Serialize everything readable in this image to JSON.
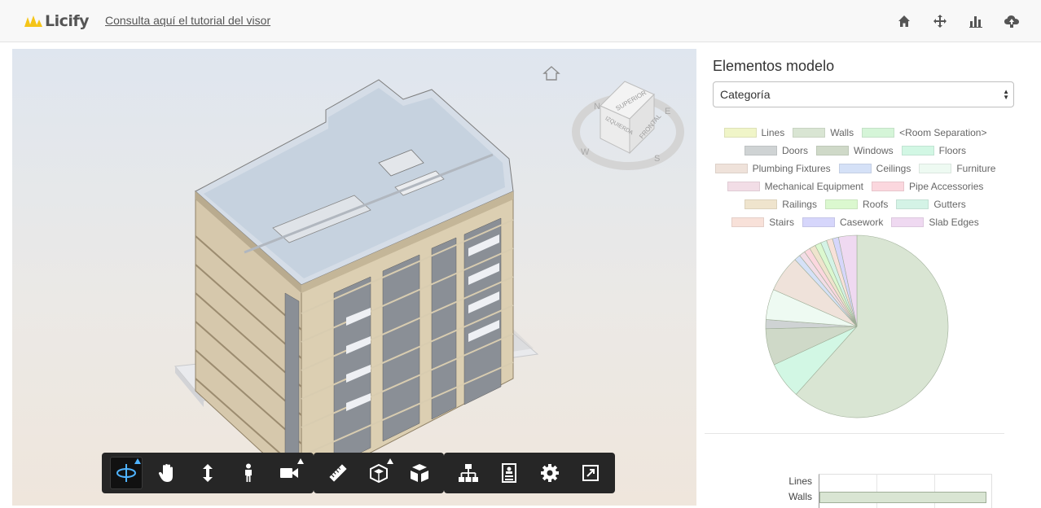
{
  "header": {
    "logo_text": "Licify",
    "tutorial_link": "Consulta aquí el tutorial del visor",
    "icons": [
      "home-icon",
      "move-icon",
      "bar-chart-icon",
      "cloud-upload-icon"
    ]
  },
  "viewer": {
    "viewcube": {
      "top": "SUPERIOR",
      "front": "FRONTAL",
      "left": "IZQUIERDA"
    },
    "compass": [
      "N",
      "E",
      "S",
      "W"
    ],
    "toolbar": {
      "navigation": [
        "orbit-icon",
        "pan-icon",
        "dolly-icon",
        "first-person-icon",
        "camera-icon"
      ],
      "modeling": [
        "measure-icon",
        "section-icon",
        "explode-icon"
      ],
      "settings": [
        "model-browser-icon",
        "properties-icon",
        "settings-icon",
        "fullscreen-icon"
      ]
    }
  },
  "panel": {
    "title": "Elementos modelo",
    "select_value": "Categoría"
  },
  "chart_data": [
    {
      "type": "pie",
      "legend": [
        [
          "Lines",
          "Walls",
          "<Room Separation>"
        ],
        [
          "Doors",
          "Windows",
          "Floors"
        ],
        [
          "Plumbing Fixtures",
          "Ceilings",
          "Furniture"
        ],
        [
          "Mechanical Equipment",
          "Pipe Accessories"
        ],
        [
          "Railings",
          "Roofs",
          "Gutters"
        ],
        [
          "Stairs",
          "Casework",
          "Slab Edges"
        ]
      ],
      "categories": [
        "Walls",
        "Floors",
        "Windows",
        "Doors",
        "Lines",
        "Furniture",
        "Plumbing Fixtures",
        "Ceilings",
        "Mechanical Equipment",
        "Pipe Accessories",
        "Railings",
        "Roofs",
        "Gutters",
        "Stairs",
        "Casework",
        "Slab Edges"
      ],
      "values": [
        57,
        6,
        6,
        1.5,
        0,
        5,
        6,
        1,
        1,
        1,
        1,
        1,
        1,
        1,
        1,
        3
      ],
      "colors": {
        "Lines": "#f0f5c8",
        "Walls": "#d9e5d3",
        "<Room Separation>": "#d5f5d8",
        "Doors": "#cfd3d4",
        "Windows": "#cfd9c8",
        "Floors": "#d2f7e4",
        "Plumbing Fixtures": "#efe2da",
        "Ceilings": "#d5e1f7",
        "Furniture": "#eefaf2",
        "Mechanical Equipment": "#f2dde6",
        "Pipe Accessories": "#fbd7de",
        "Railings": "#efe4cd",
        "Roofs": "#dbf8cf",
        "Gutters": "#d4f3e6",
        "Stairs": "#f8e1d9",
        "Casework": "#d6d6fb",
        "Slab Edges": "#efd9f1"
      }
    },
    {
      "type": "bar",
      "categories": [
        "Lines",
        "Walls"
      ],
      "values": [
        0,
        3000
      ],
      "xlim": [
        0,
        3000
      ]
    }
  ]
}
